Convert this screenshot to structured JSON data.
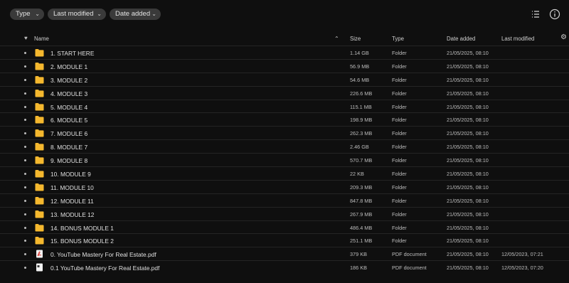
{
  "filters": {
    "type_label": "Type",
    "last_modified_label": "Last modified",
    "date_added_label": "Date added"
  },
  "toolbar_icons": [
    "list-view-icon",
    "info-icon"
  ],
  "columns": {
    "name": "Name",
    "size": "Size",
    "type": "Type",
    "date_added": "Date added",
    "last_modified": "Last modified"
  },
  "colors": {
    "folder": "#f5b82e",
    "pdf": "#e0443e",
    "background": "#0f0f0f"
  },
  "files": [
    {
      "name": "1. START HERE",
      "size": "1.14 GB",
      "type": "Folder",
      "date_added": "21/05/2025, 08:10",
      "last_modified": "",
      "icon": "folder-icon"
    },
    {
      "name": "2. MODULE 1",
      "size": "56.9 MB",
      "type": "Folder",
      "date_added": "21/05/2025, 08:10",
      "last_modified": "",
      "icon": "folder-icon"
    },
    {
      "name": "3. MODULE 2",
      "size": "54.6 MB",
      "type": "Folder",
      "date_added": "21/05/2025, 08:10",
      "last_modified": "",
      "icon": "folder-icon"
    },
    {
      "name": "4. MODULE 3",
      "size": "226.6 MB",
      "type": "Folder",
      "date_added": "21/05/2025, 08:10",
      "last_modified": "",
      "icon": "folder-icon"
    },
    {
      "name": "5. MODULE 4",
      "size": "115.1 MB",
      "type": "Folder",
      "date_added": "21/05/2025, 08:10",
      "last_modified": "",
      "icon": "folder-icon"
    },
    {
      "name": "6. MODULE 5",
      "size": "198.9 MB",
      "type": "Folder",
      "date_added": "21/05/2025, 08:10",
      "last_modified": "",
      "icon": "folder-icon"
    },
    {
      "name": "7. MODULE 6",
      "size": "262.3 MB",
      "type": "Folder",
      "date_added": "21/05/2025, 08:10",
      "last_modified": "",
      "icon": "folder-icon"
    },
    {
      "name": "8. MODULE 7",
      "size": "2.46 GB",
      "type": "Folder",
      "date_added": "21/05/2025, 08:10",
      "last_modified": "",
      "icon": "folder-icon"
    },
    {
      "name": "9. MODULE 8",
      "size": "570.7 MB",
      "type": "Folder",
      "date_added": "21/05/2025, 08:10",
      "last_modified": "",
      "icon": "folder-icon"
    },
    {
      "name": "10. MODULE 9",
      "size": "22 KB",
      "type": "Folder",
      "date_added": "21/05/2025, 08:10",
      "last_modified": "",
      "icon": "folder-icon"
    },
    {
      "name": "11. MODULE 10",
      "size": "209.3 MB",
      "type": "Folder",
      "date_added": "21/05/2025, 08:10",
      "last_modified": "",
      "icon": "folder-icon"
    },
    {
      "name": "12. MODULE 11",
      "size": "847.8 MB",
      "type": "Folder",
      "date_added": "21/05/2025, 08:10",
      "last_modified": "",
      "icon": "folder-icon"
    },
    {
      "name": "13. MODULE 12",
      "size": "267.9 MB",
      "type": "Folder",
      "date_added": "21/05/2025, 08:10",
      "last_modified": "",
      "icon": "folder-icon"
    },
    {
      "name": "14. BONUS MODULE 1",
      "size": "486.4 MB",
      "type": "Folder",
      "date_added": "21/05/2025, 08:10",
      "last_modified": "",
      "icon": "folder-icon"
    },
    {
      "name": "15. BONUS MODULE 2",
      "size": "251.1 MB",
      "type": "Folder",
      "date_added": "21/05/2025, 08:10",
      "last_modified": "",
      "icon": "folder-icon"
    },
    {
      "name": "0. YouTube Mastery For Real Estate.pdf",
      "size": "379 KB",
      "type": "PDF document",
      "date_added": "21/05/2025, 08:10",
      "last_modified": "12/05/2023, 07:21",
      "icon": "pdf-icon"
    },
    {
      "name": "0.1 YouTube Mastery For Real Estate.pdf",
      "size": "186 KB",
      "type": "PDF document",
      "date_added": "21/05/2025, 08:10",
      "last_modified": "12/05/2023, 07:20",
      "icon": "document-icon"
    }
  ]
}
